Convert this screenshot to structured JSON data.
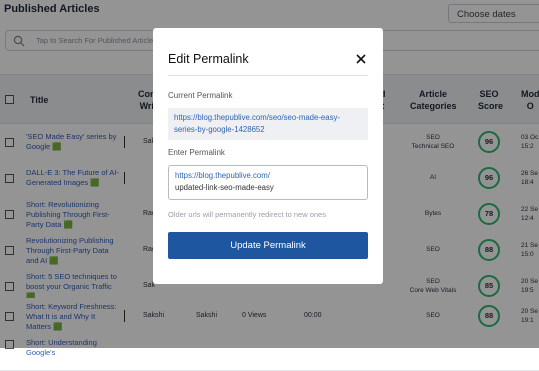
{
  "page": {
    "title": "Published Articles"
  },
  "filters": {
    "date_placeholder": "Choose dates"
  },
  "search": {
    "placeholder": "Tap to Search For Published Articles"
  },
  "table": {
    "headers": {
      "title": "Title",
      "contributor_writer": [
        "Con",
        "Wri"
      ],
      "word_count": [
        "d",
        "t"
      ],
      "article_categories": [
        "Article",
        "Categories"
      ],
      "seo_score": [
        "SEO",
        "Score"
      ],
      "modified_on": [
        "Mod",
        "O"
      ]
    },
    "rows": [
      {
        "title": "'SEO Made Easy' series by Google 🟩",
        "author": "Sakshi",
        "editor": "",
        "views": "",
        "time": "",
        "categories": [
          "SEO",
          "Technical SEO"
        ],
        "score": "96",
        "modified": [
          "03 Oc",
          "15:2"
        ]
      },
      {
        "title": "DALL-E 3: The Future of AI-Generated Images 🟩",
        "author": "",
        "editor": "",
        "views": "",
        "time": "",
        "categories": [
          "AI"
        ],
        "score": "96",
        "modified": [
          "26 Se",
          "18:4"
        ]
      },
      {
        "title": "Short: Revolutionizing Publishing Through First-Party Data 🟩",
        "author": "Rag",
        "editor": "",
        "views": "",
        "time": "",
        "categories": [
          "Bytes"
        ],
        "score": "78",
        "modified": [
          "22 Se",
          "12:4"
        ]
      },
      {
        "title": "Revolutionizing Publishing Through First-Party Data and AI 🟩",
        "author": "Rag",
        "editor": "",
        "views": "",
        "time": "",
        "categories": [
          "SEO"
        ],
        "score": "88",
        "modified": [
          "21 Se",
          "15:0"
        ]
      },
      {
        "title": "Short: 5 SEO techniques to boost your Organic Traffic 🟩",
        "author": "Sak",
        "editor": "",
        "views": "",
        "time": "",
        "categories": [
          "SEO",
          "Core Web Vitals"
        ],
        "score": "85",
        "modified": [
          "20 Se",
          "19:5"
        ]
      },
      {
        "title": "Short: Keyword Freshness: What It is and Why It Matters 🟩",
        "author": "Sakshi",
        "editor": "Sakshi",
        "views": "0 Views",
        "time": "00:00",
        "categories": [
          "SEO"
        ],
        "score": "88",
        "modified": [
          "20 Se",
          "19:1"
        ]
      },
      {
        "title": "Short: Understanding Google's",
        "author": "",
        "editor": "",
        "views": "",
        "time": "",
        "categories": [],
        "score": "",
        "modified": []
      }
    ]
  },
  "modal": {
    "title": "Edit Permalink",
    "current_label": "Current Permalink",
    "current_value": "https://blog.thepublive.com/seo/seo-made-easy-series-by-google-1428652",
    "enter_label": "Enter Permalink",
    "enter_prefix": "https://blog.thepublive.com/",
    "enter_value": "updated-link-seo-made-easy",
    "hint": "Older urls will permanently redirect to new ones",
    "button_label": "Update Permalink"
  },
  "colors": {
    "accent": "#1e56a0",
    "score_ring": "#2eb872",
    "overlay": "rgba(0,0,0,0.42)"
  }
}
